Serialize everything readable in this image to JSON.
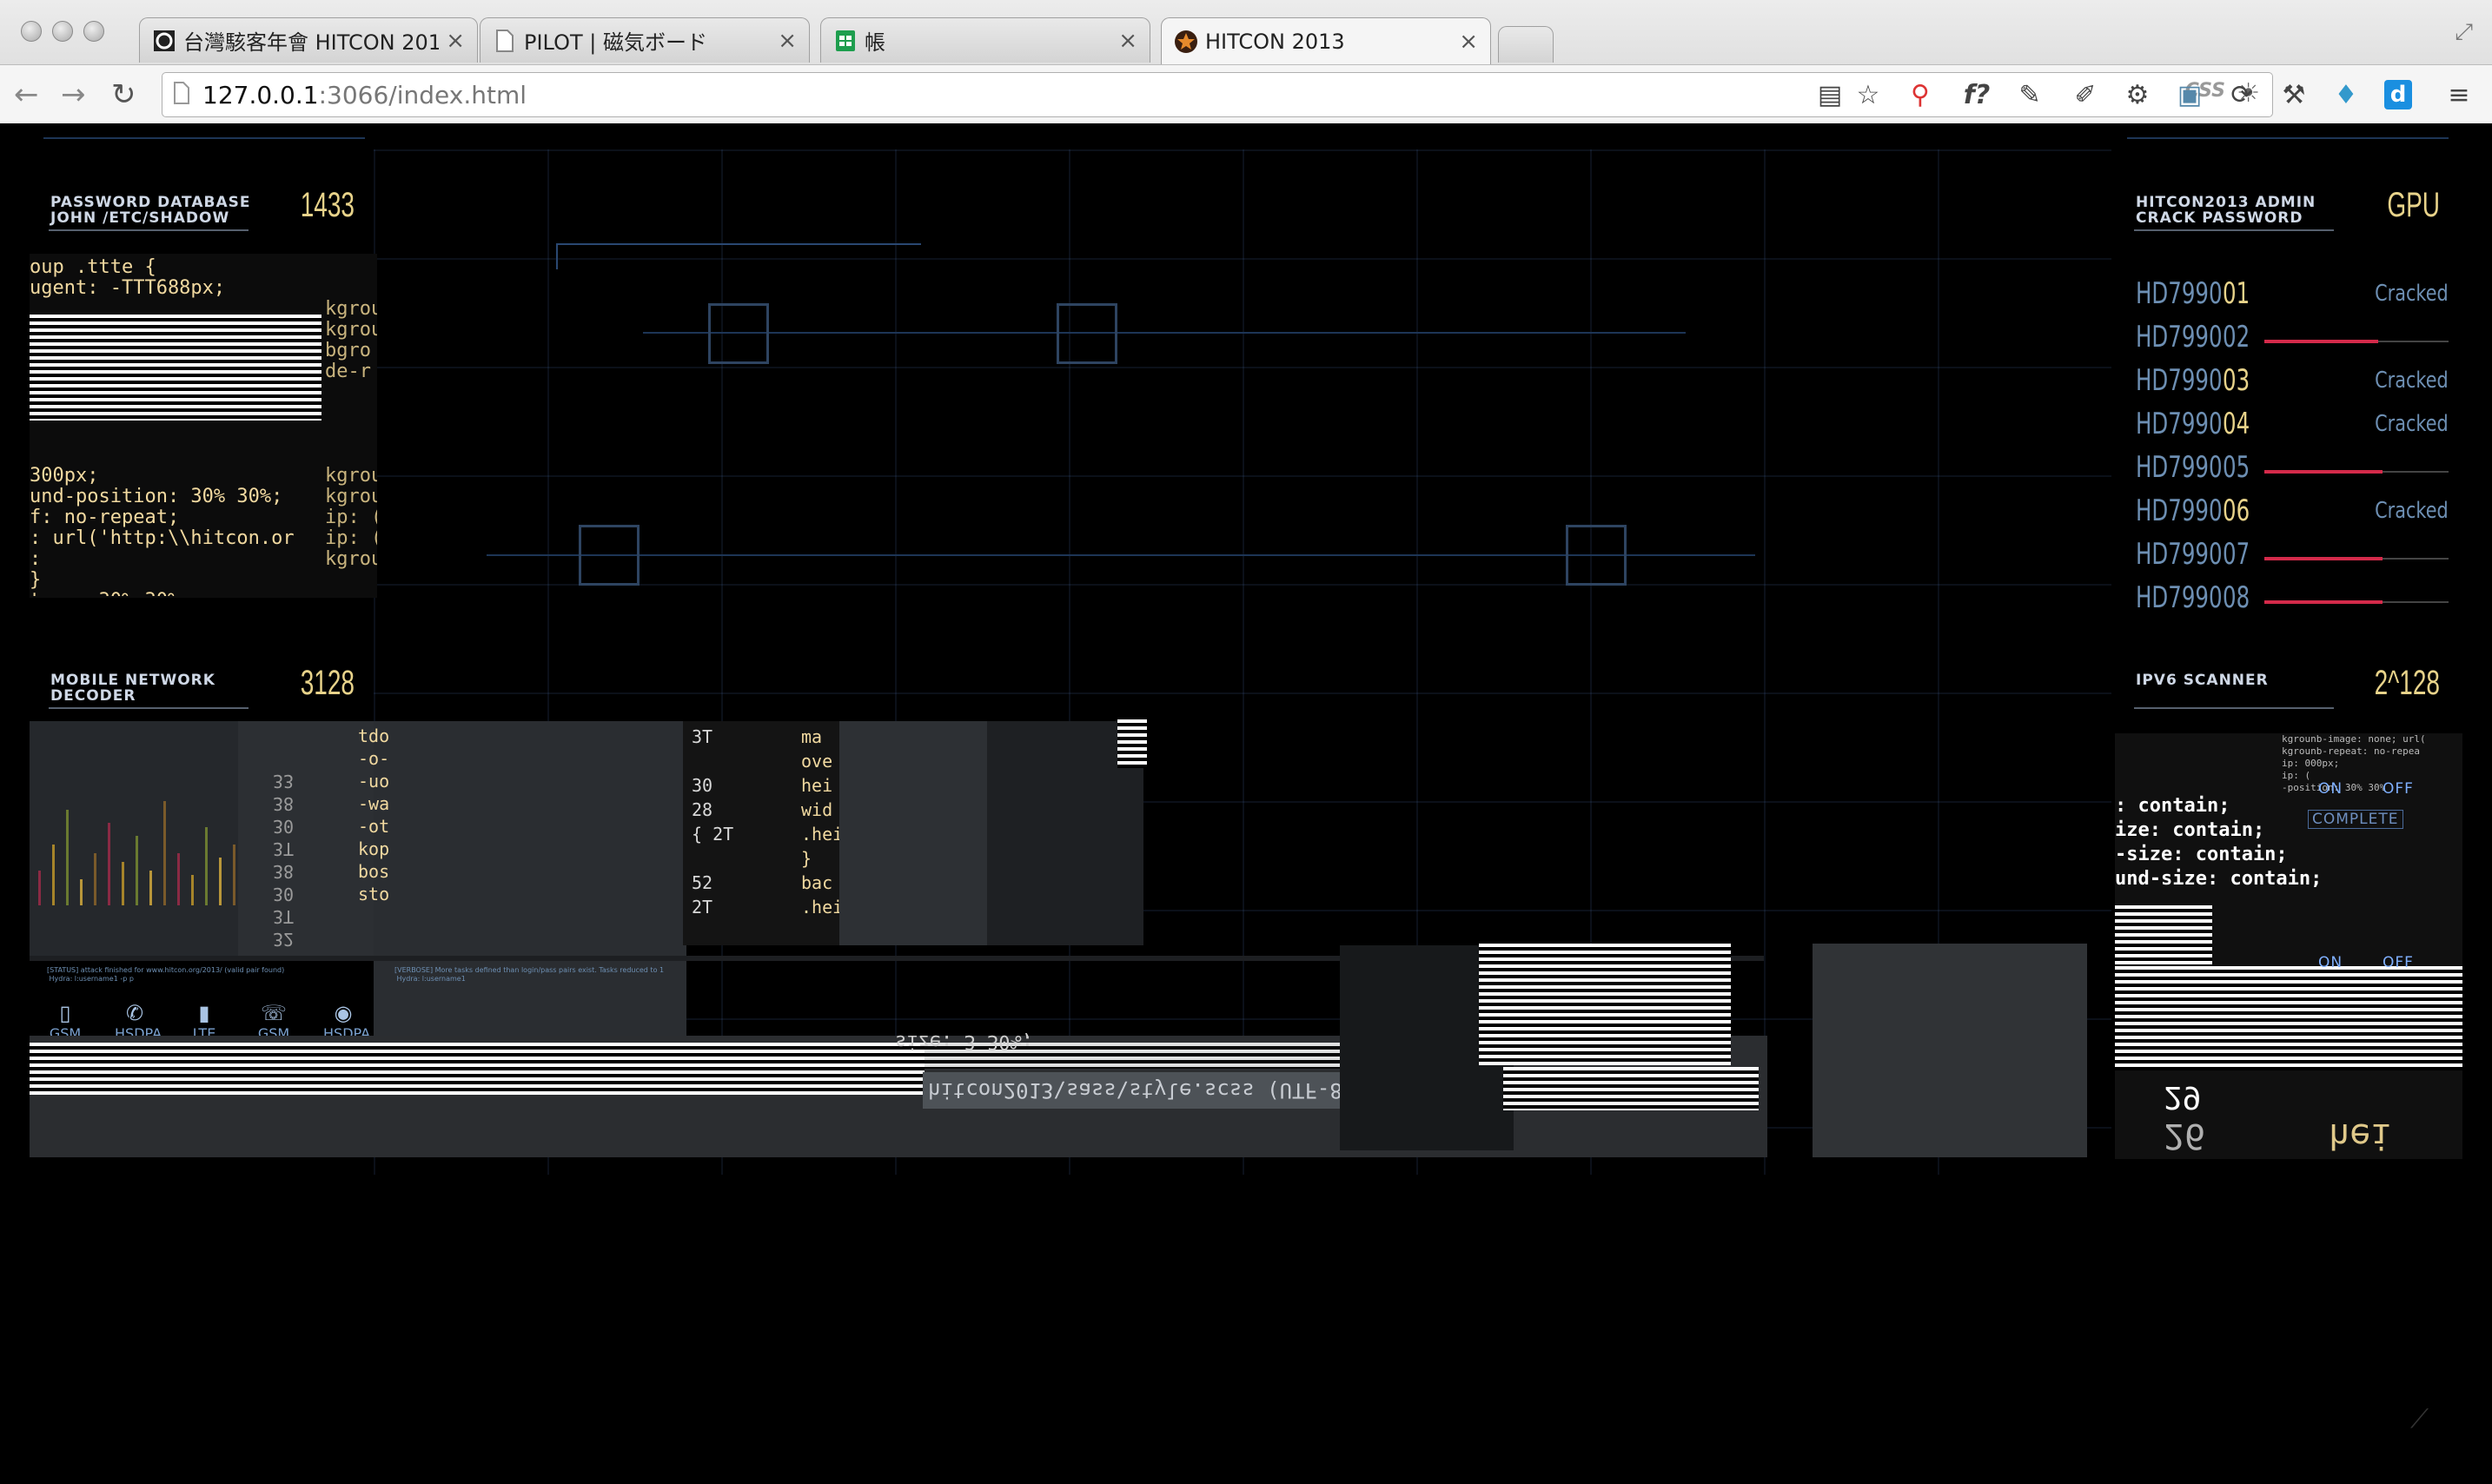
{
  "browser": {
    "tabs": [
      {
        "title": "台灣駭客年會 HITCON 2013",
        "icon": "hitcon-logo-icon"
      },
      {
        "title": "PILOT | 磁気ボード",
        "icon": "page-icon"
      },
      {
        "title": "帳",
        "icon": "sheets-icon"
      },
      {
        "title": "HITCON 2013",
        "icon": "star-badge-icon"
      }
    ],
    "close_glyph": "×",
    "url_host": "127.0.0.1",
    "url_rest": ":3066/index.html",
    "css_label": "CSS",
    "fx_label": "f?"
  },
  "panels": {
    "password_db": {
      "title_line1": "PASSWORD DATABASE",
      "title_line2": "JOHN /ETC/SHADOW",
      "number": "1433"
    },
    "gpu": {
      "title_line1": "HITCON2013 ADMIN",
      "title_line2": "CRACK PASSWORD",
      "number": "GPU"
    },
    "mobile": {
      "title_line1": "MOBILE NETWORK",
      "title_line2": "DECODER",
      "number": "3128"
    },
    "ipv6": {
      "title_line1": "IPV6 SCANNER",
      "number": "2^128"
    }
  },
  "gpu_rows": [
    {
      "name": "HD7990",
      "num": "01",
      "status": "Cracked",
      "progress": 1.0,
      "num_color": "#e8d38a"
    },
    {
      "name": "HD7990",
      "num": "02",
      "status": "",
      "progress": 0.62,
      "num_color": "#6d8fb3"
    },
    {
      "name": "HD7990",
      "num": "03",
      "status": "Cracked",
      "progress": 1.0,
      "num_color": "#e8d38a"
    },
    {
      "name": "HD7990",
      "num": "04",
      "status": "Cracked",
      "progress": 1.0,
      "num_color": "#e8d38a"
    },
    {
      "name": "HD7990",
      "num": "05",
      "status": "",
      "progress": 0.64,
      "num_color": "#6d8fb3"
    },
    {
      "name": "HD7990",
      "num": "06",
      "status": "Cracked",
      "progress": 1.0,
      "num_color": "#e8d38a"
    },
    {
      "name": "HD7990",
      "num": "07",
      "status": "",
      "progress": 0.64,
      "num_color": "#6d8fb3"
    },
    {
      "name": "HD7990",
      "num": "08",
      "status": "",
      "progress": 0.64,
      "num_color": "#6d8fb3"
    }
  ],
  "mobile_buttons": [
    {
      "label": "GSM",
      "icon": "phone-device-icon"
    },
    {
      "label": "HSDPA",
      "icon": "handset-icon"
    },
    {
      "label": "LTE",
      "icon": "mobile-device-icon"
    },
    {
      "label": "GSM",
      "icon": "signal-phone-icon"
    },
    {
      "label": "HSDPA",
      "icon": "whatsapp-icon"
    }
  ],
  "ipv6_controls": {
    "on": "ON",
    "off": "OFF",
    "complete": "COMPLETE"
  },
  "code_left": "oup .ttte {\nugent: -TTT688px;\n\n\n\n\n\n\n\n\n300px;\nund-position: 30% 30%;\nf: no-repeat;\n: url('http:\\\\hitcon.or\n:\n}\nt:--- 30% 30%",
  "code_left_side": "\n\nkgrou\nkgrou\nbgro\nde-r\n\n\n\n\nkgrou\nkgrou\nip: (\nip: (\nkgrou",
  "code_mid1": "32\n3T\n30\n38\n3T\n30\n38\n33",
  "code_mid2": "tdo\n-o-\n-uo\n-wa\n-ot\nkop\nbos\nsto",
  "code_mid3": "3T\n\n30\n28\n{ 2T\n\n52\n2T",
  "code_mid4": "ma\nove\nhei\nwid\n.heig\n}\nbac\n.heig",
  "ipv6_code": ": contain;\nize: contain;\n-size: contain;\nund-size: contain;",
  "ipv6_small": "kgrounb-image: none; url(\nkgrounb-repeat: no-repea\nip: 000px;\nip: (\n-position: 30% 30%",
  "status_text_1": "[STATUS] attack finished for www.hitcon.org/2013/ (valid pair found)\n Hydra: l:username1 -p p",
  "status_text_2": "[VERBOSE] More tasks defined than login/pass pairs exist. Tasks reduced to 1\n Hydra: l:username1",
  "footer_file": "hitcon2013\\sass\\style.scss (UTF-8)",
  "footer_code": "size: 3 30%;",
  "big_digits_1": "26",
  "big_digits_2": "hei",
  "big_digits_3": "29"
}
